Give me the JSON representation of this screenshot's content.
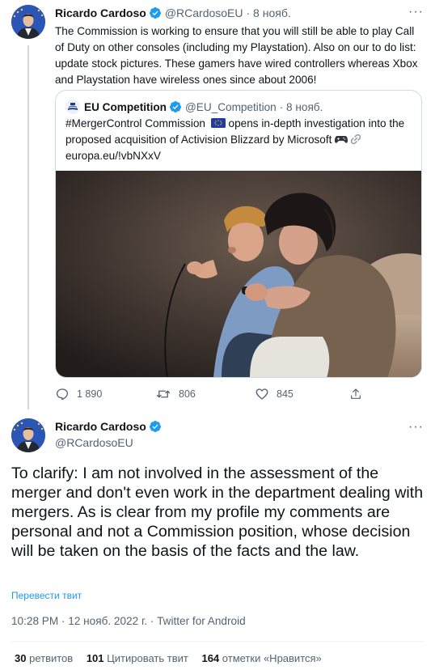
{
  "tweet1": {
    "author_name": "Ricardo Cardoso",
    "author_handle": "@RCardosoEU",
    "time": "· 8 нояб.",
    "more_label": "···",
    "text": "The Commission is working to ensure that you will still be able to play Call of Duty on other consoles (including my Playstation). Also on our to do list: update stock pictures. These gamers have wired controllers whereas Xbox and Playstation have wireless ones since about 2006!",
    "quote": {
      "author_name": "EU Competition",
      "author_handle": "@EU_Competition",
      "time": "· 8 нояб.",
      "text_part1": "#MergerControl Commission",
      "text_part2": " opens in-depth investigation into the proposed acquisition of Activision Blizzard by Microsoft ",
      "link": "europa.eu/!vbNXxV"
    },
    "actions": {
      "replies": "1 890",
      "retweets": "806",
      "likes": "845"
    }
  },
  "tweet2": {
    "author_name": "Ricardo Cardoso",
    "author_handle": "@RCardosoEU",
    "more_label": "···",
    "text": "To clarify: I am not involved in the assessment of the merger and don't even work in the department dealing with mergers. As is clear from my profile my comments are personal and not a Commission position, whose decision will be taken on the basis of the facts and the law.",
    "translate_label": "Перевести твит",
    "meta": "10:28 PM · 12 нояб. 2022 г. · Twitter for Android",
    "stats": {
      "retweets_count": "30",
      "retweets_label": "ретвитов",
      "quotes_count": "101",
      "quotes_label": "Цитировать твит",
      "likes_count": "164",
      "likes_label": "отметки «Нравится»"
    }
  },
  "colors": {
    "accent": "#1d9bf0",
    "muted": "#536471",
    "text": "#0f1419",
    "border": "#cfd9de"
  }
}
